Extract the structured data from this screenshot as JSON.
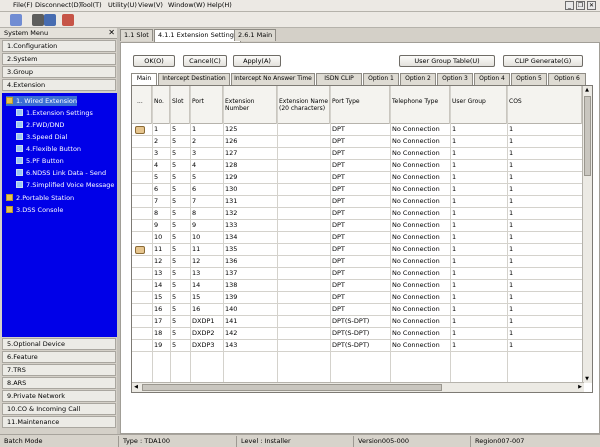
{
  "menu": [
    "File(F)",
    "Disconnect(D)",
    "Tool(T)",
    "Utility(U)",
    "View(V)",
    "Window(W)",
    "Help(H)"
  ],
  "window_buttons": [
    "_",
    "❐",
    "✕"
  ],
  "toolbar_icons": [
    "connect-icon",
    "system-icon",
    "network-icon",
    "plugin-icon"
  ],
  "sidebar": {
    "title": "System Menu",
    "close": "✕",
    "top_items": [
      "1.Configuration",
      "2.System",
      "3.Group",
      "4.Extension"
    ],
    "tree": [
      {
        "label": "1. Wired Extension",
        "level": 0,
        "selected": true,
        "folder": true
      },
      {
        "label": "1.Extension Settings",
        "level": 1,
        "selected": false,
        "folder": false
      },
      {
        "label": "2.FWD/DND",
        "level": 1,
        "selected": false,
        "folder": false
      },
      {
        "label": "3.Speed Dial",
        "level": 1,
        "selected": false,
        "folder": false
      },
      {
        "label": "4.Flexible Button",
        "level": 1,
        "selected": false,
        "folder": false
      },
      {
        "label": "5.PF Button",
        "level": 1,
        "selected": false,
        "folder": false
      },
      {
        "label": "6.NDSS Link Data - Send",
        "level": 1,
        "selected": false,
        "folder": false
      },
      {
        "label": "7.Simplified Voice Message",
        "level": 1,
        "selected": false,
        "folder": false
      },
      {
        "label": "2.Portable Station",
        "level": 0,
        "selected": false,
        "folder": true
      },
      {
        "label": "3.DSS Console",
        "level": 0,
        "selected": false,
        "folder": true
      }
    ],
    "bottom_items": [
      "5.Optional Device",
      "6.Feature",
      "7.TRS",
      "8.ARS",
      "9.Private Network",
      "10.CO & Incoming Call",
      "11.Maintenance"
    ]
  },
  "doc_tabs": [
    "1.1 Slot",
    "4.1.1 Extension Settings",
    "2.6.1 Main"
  ],
  "buttons": {
    "ok": "OK(O)",
    "cancel": "Cancel(C)",
    "apply": "Apply(A)",
    "user_group": "User Group Table(U)",
    "clip": "CLIP Generate(G)"
  },
  "sub_tabs": [
    "Main",
    "Intercept Destination",
    "Intercept No Answer Time",
    "ISDN CLIP",
    "Option 1",
    "Option 2",
    "Option 3",
    "Option 4",
    "Option 5",
    "Option 6"
  ],
  "table": {
    "corner": "...",
    "columns": [
      "No.",
      "Slot",
      "Port",
      "Extension Number",
      "Extension Name (20 characters)",
      "Port Type",
      "Telephone Type",
      "User Group",
      "COS"
    ],
    "rows": [
      [
        "1",
        "5",
        "1",
        "125",
        "",
        "DPT",
        "No Connection",
        "1",
        "1"
      ],
      [
        "2",
        "5",
        "2",
        "126",
        "",
        "DPT",
        "No Connection",
        "1",
        "1"
      ],
      [
        "3",
        "5",
        "3",
        "127",
        "",
        "DPT",
        "No Connection",
        "1",
        "1"
      ],
      [
        "4",
        "5",
        "4",
        "128",
        "",
        "DPT",
        "No Connection",
        "1",
        "1"
      ],
      [
        "5",
        "5",
        "5",
        "129",
        "",
        "DPT",
        "No Connection",
        "1",
        "1"
      ],
      [
        "6",
        "5",
        "6",
        "130",
        "",
        "DPT",
        "No Connection",
        "1",
        "1"
      ],
      [
        "7",
        "5",
        "7",
        "131",
        "",
        "DPT",
        "No Connection",
        "1",
        "1"
      ],
      [
        "8",
        "5",
        "8",
        "132",
        "",
        "DPT",
        "No Connection",
        "1",
        "1"
      ],
      [
        "9",
        "5",
        "9",
        "133",
        "",
        "DPT",
        "No Connection",
        "1",
        "1"
      ],
      [
        "10",
        "5",
        "10",
        "134",
        "",
        "DPT",
        "No Connection",
        "1",
        "1"
      ],
      [
        "11",
        "5",
        "11",
        "135",
        "",
        "DPT",
        "No Connection",
        "1",
        "1"
      ],
      [
        "12",
        "5",
        "12",
        "136",
        "",
        "DPT",
        "No Connection",
        "1",
        "1"
      ],
      [
        "13",
        "5",
        "13",
        "137",
        "",
        "DPT",
        "No Connection",
        "1",
        "1"
      ],
      [
        "14",
        "5",
        "14",
        "138",
        "",
        "DPT",
        "No Connection",
        "1",
        "1"
      ],
      [
        "15",
        "5",
        "15",
        "139",
        "",
        "DPT",
        "No Connection",
        "1",
        "1"
      ],
      [
        "16",
        "5",
        "16",
        "140",
        "",
        "DPT",
        "No Connection",
        "1",
        "1"
      ],
      [
        "17",
        "5",
        "DXDP1",
        "141",
        "",
        "DPT(S-DPT)",
        "No Connection",
        "1",
        "1"
      ],
      [
        "18",
        "5",
        "DXDP2",
        "142",
        "",
        "DPT(S-DPT)",
        "No Connection",
        "1",
        "1"
      ],
      [
        "19",
        "5",
        "DXDP3",
        "143",
        "",
        "DPT(S-DPT)",
        "No Connection",
        "1",
        "1"
      ]
    ],
    "marked_rows": [
      1,
      11
    ]
  },
  "status": {
    "mode": "Batch Mode",
    "type": "Type : TDA100",
    "level": "Level : Installer",
    "version": "Version005-000",
    "region": "Region007-007"
  }
}
